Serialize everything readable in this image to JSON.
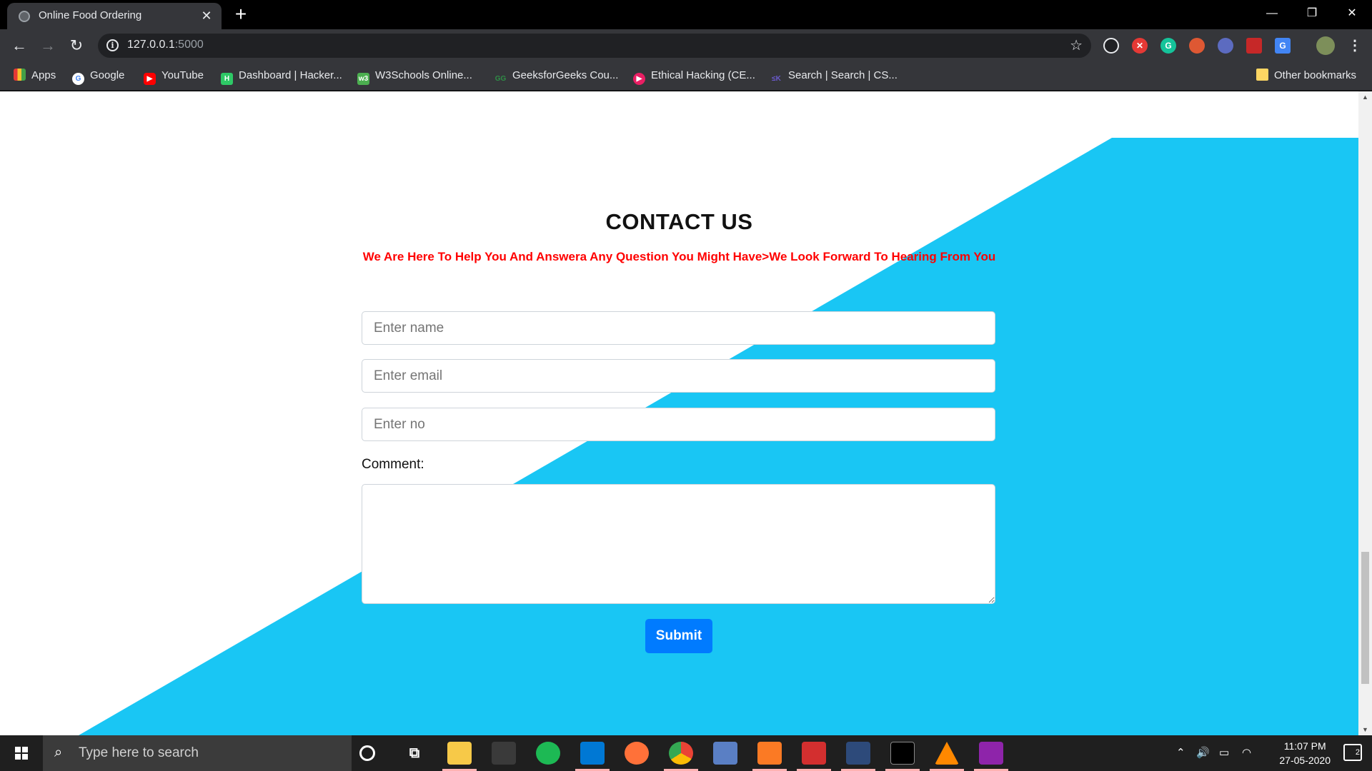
{
  "browser": {
    "tab_title": "Online Food Ordering",
    "tab_close": "✕",
    "new_tab": "+",
    "window_controls": {
      "minimize": "—",
      "restore": "❐",
      "close": "✕"
    },
    "url_host": "127.0.0.1",
    "url_port": ":5000",
    "bookmarks": [
      {
        "label": "Apps",
        "icon": "apps-grid-icon",
        "color": "#e8eaed"
      },
      {
        "label": "Google",
        "icon": "google-icon",
        "color": "#ffffff"
      },
      {
        "label": "YouTube",
        "icon": "youtube-icon",
        "color": "#ff0000"
      },
      {
        "label": "Dashboard | Hacker...",
        "icon": "hackerrank-icon",
        "color": "#2ec866"
      },
      {
        "label": "W3Schools Online...",
        "icon": "w3schools-icon",
        "color": "#4caf50"
      },
      {
        "label": "GeeksforGeeks Cou...",
        "icon": "geeksforgeeks-icon",
        "color": "#2f8d46"
      },
      {
        "label": "Ethical Hacking (CE...",
        "icon": "ethical-hacking-icon",
        "color": "#e91e63"
      },
      {
        "label": "Search | Search | CS...",
        "icon": "csk-icon",
        "color": "#6a5acd"
      }
    ],
    "other_bookmarks": "Other bookmarks"
  },
  "page": {
    "heading": "CONTACT US",
    "subheading": "We Are Here To Help You And Answera Any Question You Might Have>We Look Forward To Hearing From You",
    "name_placeholder": "Enter name",
    "email_placeholder": "Enter email",
    "phone_placeholder": "Enter no",
    "comment_label": "Comment:",
    "submit_label": "Submit",
    "accent_color": "#19c6f4",
    "button_color": "#007bff",
    "subheading_color": "#ff0000"
  },
  "taskbar": {
    "search_placeholder": "Type here to search",
    "time": "11:07 PM",
    "date": "27-05-2020",
    "notification_count": "2"
  }
}
